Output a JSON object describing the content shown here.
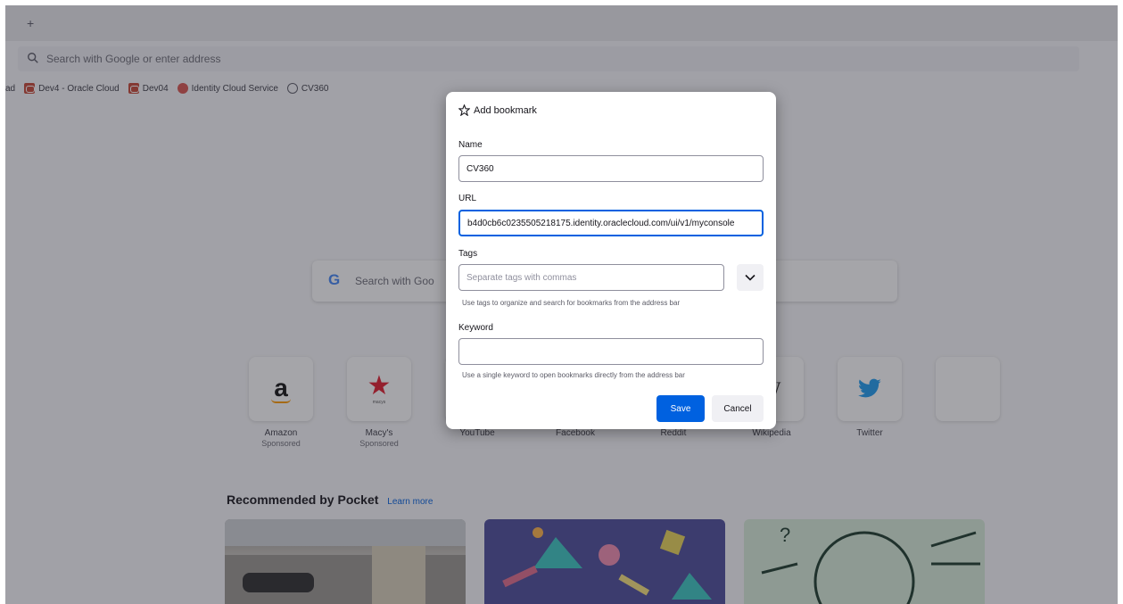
{
  "browser": {
    "newtab_button": "+",
    "urlbar_placeholder": "Search with Google or enter address"
  },
  "bookmarks_bar": {
    "items": [
      {
        "label": "ad"
      },
      {
        "label": "Dev4 - Oracle Cloud"
      },
      {
        "label": "Dev04"
      },
      {
        "label": "Identity Cloud Service"
      },
      {
        "label": "CV360"
      }
    ]
  },
  "new_tab": {
    "search_placeholder": "Search with Goo",
    "tiles": [
      {
        "label": "Amazon",
        "sublabel": "Sponsored"
      },
      {
        "label": "Macy's",
        "sublabel": "Sponsored"
      },
      {
        "label": "YouTube"
      },
      {
        "label": "Facebook"
      },
      {
        "label": "Reddit"
      },
      {
        "label": "Wikipedia"
      },
      {
        "label": "Twitter"
      },
      {
        "label": ""
      }
    ],
    "macys_word": "macys",
    "pocket": {
      "title": "Recommended by Pocket",
      "learn_more": "Learn more"
    }
  },
  "dialog": {
    "title": "Add bookmark",
    "name_label": "Name",
    "name_value": "CV360",
    "url_label": "URL",
    "url_value": "b4d0cb6c0235505218175.identity.oraclecloud.com/ui/v1/myconsole",
    "tags_label": "Tags",
    "tags_placeholder": "Separate tags with commas",
    "tags_hint": "Use tags to organize and search for bookmarks from the address bar",
    "keyword_label": "Keyword",
    "keyword_value": "",
    "keyword_hint": "Use a single keyword to open bookmarks directly from the address bar",
    "save_label": "Save",
    "cancel_label": "Cancel"
  },
  "colors": {
    "accent": "#0061e0",
    "overlay": "#282832",
    "twitter": "#1d9bf0",
    "oracle": "#c74634"
  }
}
